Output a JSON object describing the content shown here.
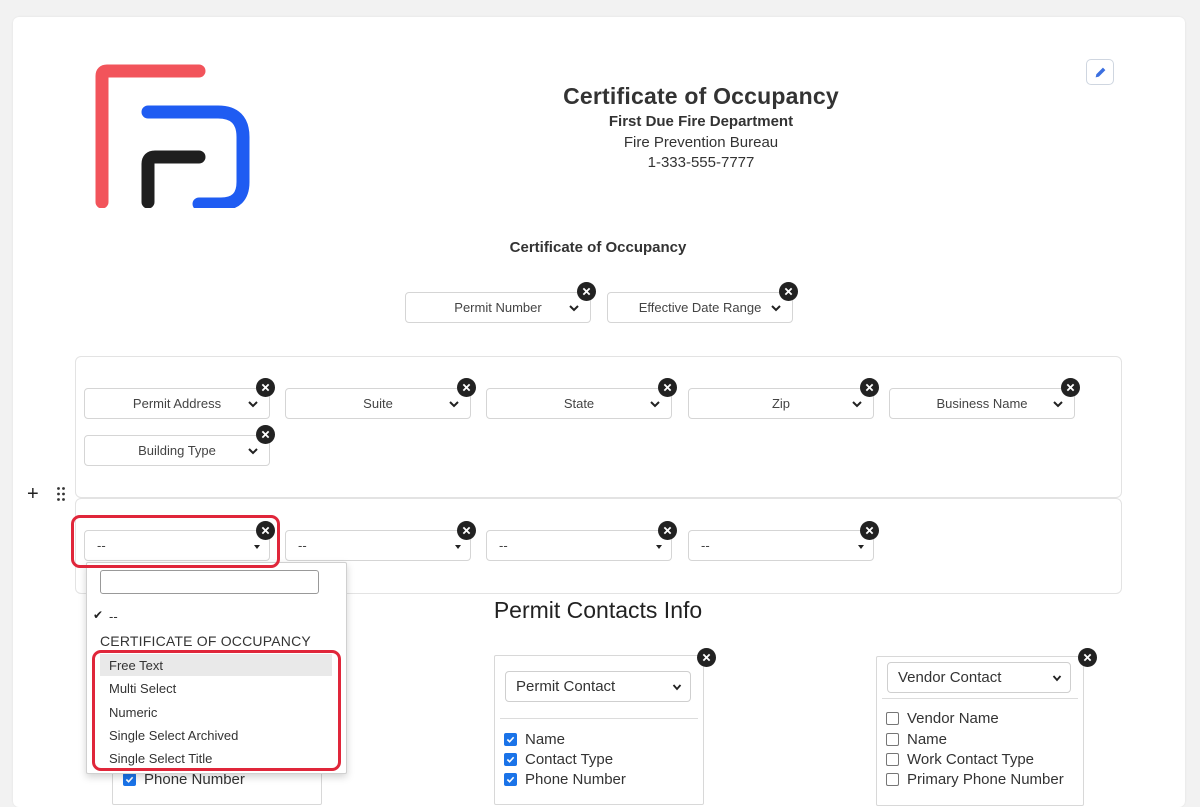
{
  "header": {
    "title": "Certificate of Occupancy",
    "department": "First Due Fire Department",
    "bureau": "Fire Prevention Bureau",
    "phone": "1-333-555-7777"
  },
  "logo": {
    "colors": {
      "red": "#f2545b",
      "black": "#1f1f1f",
      "blue": "#1f5cf2"
    }
  },
  "subtitle": "Certificate of Occupancy",
  "top_filters": [
    {
      "label": "Permit Number"
    },
    {
      "label": "Effective Date Range"
    }
  ],
  "field_panel": {
    "fields": [
      {
        "label": "Permit Address"
      },
      {
        "label": "Suite"
      },
      {
        "label": "State"
      },
      {
        "label": "Zip"
      },
      {
        "label": "Business Name"
      },
      {
        "label": "Building Type"
      }
    ]
  },
  "new_row": {
    "selects": [
      {
        "value": "--"
      },
      {
        "value": "--"
      },
      {
        "value": "--"
      },
      {
        "value": "--"
      }
    ]
  },
  "dropdown": {
    "search_value": "",
    "selected_option": "--",
    "group_label": "CERTIFICATE OF OCCUPANCY",
    "options": [
      {
        "label": "Free Text"
      },
      {
        "label": "Multi Select"
      },
      {
        "label": "Numeric"
      },
      {
        "label": "Single Select Archived"
      },
      {
        "label": "Single Select Title"
      }
    ]
  },
  "contacts_section": {
    "title": "Permit Contacts Info",
    "left_box": {
      "items": [
        {
          "label": "Phone Number",
          "checked": true
        }
      ]
    },
    "permit_box": {
      "select_value": "Permit Contact",
      "items": [
        {
          "label": "Name",
          "checked": true
        },
        {
          "label": "Contact Type",
          "checked": true
        },
        {
          "label": "Phone Number",
          "checked": true
        }
      ]
    },
    "vendor_box": {
      "select_value": "Vendor Contact",
      "items": [
        {
          "label": "Vendor Name",
          "checked": false
        },
        {
          "label": "Name",
          "checked": false
        },
        {
          "label": "Work Contact Type",
          "checked": false
        },
        {
          "label": "Primary Phone Number",
          "checked": false
        }
      ]
    }
  },
  "colors": {
    "accent": "#1a73e8",
    "highlight": "#e0263a"
  }
}
